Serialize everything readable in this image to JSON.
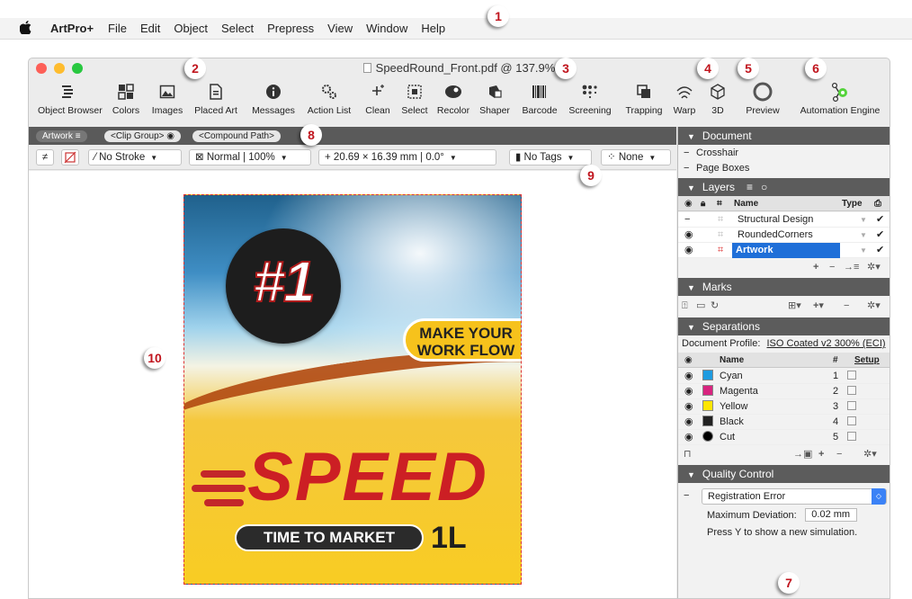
{
  "menubar": {
    "app_name": "ArtPro+",
    "items": [
      "File",
      "Edit",
      "Object",
      "Select",
      "Prepress",
      "View",
      "Window",
      "Help"
    ]
  },
  "callouts": [
    "1",
    "2",
    "3",
    "4",
    "5",
    "6",
    "7",
    "8",
    "9",
    "10"
  ],
  "window": {
    "title": "SpeedRound_Front.pdf @ 137.9%"
  },
  "toolbar": {
    "object_browser": "Object Browser",
    "colors": "Colors",
    "images": "Images",
    "placed_art": "Placed Art",
    "messages": "Messages",
    "action_list": "Action List",
    "clean": "Clean",
    "select": "Select",
    "recolor": "Recolor",
    "shaper": "Shaper",
    "barcode": "Barcode",
    "screening": "Screening",
    "trapping": "Trapping",
    "warp": "Warp",
    "three_d": "3D",
    "preview": "Preview",
    "automation_engine": "Automation Engine"
  },
  "breadcrumb": {
    "artwork": "Artwork",
    "artwork_icon": "≡",
    "clip_group": "<Clip Group>",
    "clip_icon": "◉",
    "compound_path": "<Compound Path>"
  },
  "properties": {
    "stroke": "No Stroke",
    "blend": "Normal  |  100%",
    "dimensions": "20.69 × 16.39 mm  |  0.0°",
    "tags": "No Tags",
    "none": "None"
  },
  "artwork": {
    "badge": "#1",
    "tagline_1": "MAKE YOUR",
    "tagline_2": "WORK FLOW",
    "headline": "SPEED",
    "subline": "TIME TO MARKET",
    "volume": "1L"
  },
  "panel": {
    "document": {
      "header": "Document",
      "items": [
        "Crosshair",
        "Page Boxes"
      ]
    },
    "layers": {
      "header": "Layers",
      "col_name": "Name",
      "col_type": "Type",
      "rows": [
        "Structural Design",
        "RoundedCorners",
        "Artwork"
      ]
    },
    "marks": {
      "header": "Marks"
    },
    "separations": {
      "header": "Separations",
      "profile_label": "Document Profile:",
      "profile_value": "ISO Coated v2 300% (ECI)",
      "col_name": "Name",
      "col_num": "#",
      "col_setup": "Setup",
      "rows": [
        {
          "name": "Cyan",
          "num": "1",
          "color": "#1e9be0"
        },
        {
          "name": "Magenta",
          "num": "2",
          "color": "#d8247f"
        },
        {
          "name": "Yellow",
          "num": "3",
          "color": "#ffe600"
        },
        {
          "name": "Black",
          "num": "4",
          "color": "#222222"
        },
        {
          "name": "Cut",
          "num": "5",
          "color": "#000000"
        }
      ]
    },
    "quality": {
      "header": "Quality Control",
      "selected": "Registration Error",
      "max_dev_label": "Maximum Deviation:",
      "max_dev_value": "0.02 mm",
      "hint": "Press Y to show a new simulation."
    }
  }
}
